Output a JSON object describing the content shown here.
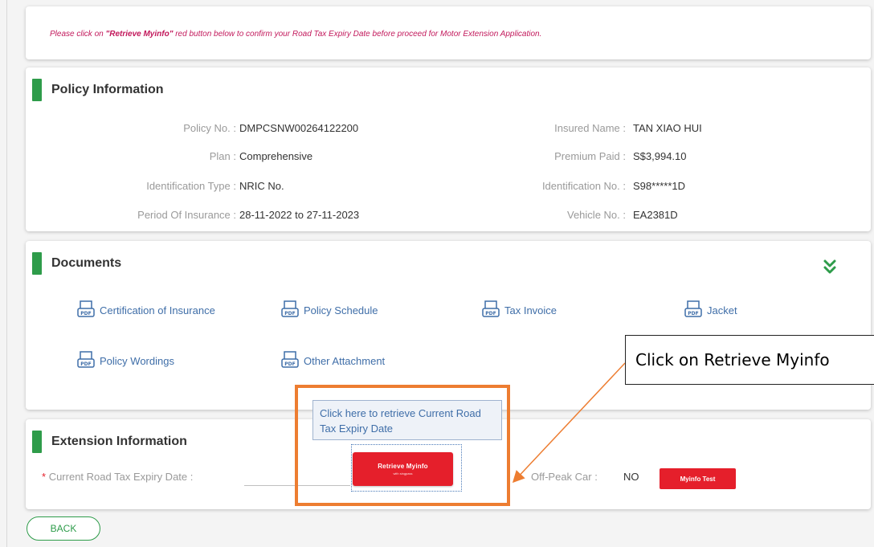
{
  "notice": {
    "prefix": "Please click on ",
    "highlight": "\"Retrieve Myinfo\"",
    "suffix": " red button below to confirm your Road Tax Expiry Date before proceed for Motor Extension Application."
  },
  "policy": {
    "title": "Policy Information",
    "fields": [
      {
        "label": "Policy No. :",
        "value": "DMPCSNW00264122200"
      },
      {
        "label": "Insured Name :",
        "value": "TAN XIAO HUI"
      },
      {
        "label": "Plan :",
        "value": "Comprehensive"
      },
      {
        "label": "Premium Paid :",
        "value": "S$3,994.10"
      },
      {
        "label": "Identification Type :",
        "value": "NRIC No."
      },
      {
        "label": "Identification No. :",
        "value": "S98*****1D"
      },
      {
        "label": "Period Of Insurance :",
        "value": "28-11-2022 to 27-11-2023"
      },
      {
        "label": "Vehicle No. :",
        "value": "EA2381D"
      }
    ]
  },
  "documents": {
    "title": "Documents",
    "items": [
      {
        "label": "Certification of Insurance"
      },
      {
        "label": "Policy Schedule"
      },
      {
        "label": "Tax Invoice"
      },
      {
        "label": "Jacket"
      },
      {
        "label": "Policy Wordings"
      },
      {
        "label": "Other Attachment"
      }
    ],
    "icon": "pdf-icon",
    "toggle_icon": "double-chevron-down-icon"
  },
  "extension": {
    "title": "Extension Information",
    "road_tax_required": "*",
    "road_tax_label": "Current Road Tax Expiry Date :",
    "road_tax_value": "",
    "offpeak_label": "Off-Peak Car :",
    "offpeak_value": "NO",
    "retrieve_button": "Retrieve Myinfo",
    "retrieve_sub": "with singpass",
    "myinfo_test_button": "Myinfo Test"
  },
  "tooltip": {
    "text": "Click here to retrieve Current Road Tax Expiry Date"
  },
  "annotation": {
    "callout": "Click on Retrieve Myinfo"
  },
  "back_button": "BACK",
  "colors": {
    "accent_green": "#2e9c4a",
    "button_red": "#e51f2b",
    "link_blue": "#3f6ea8",
    "notice_pink": "#c2185b",
    "highlight_orange": "#ed7d31"
  }
}
